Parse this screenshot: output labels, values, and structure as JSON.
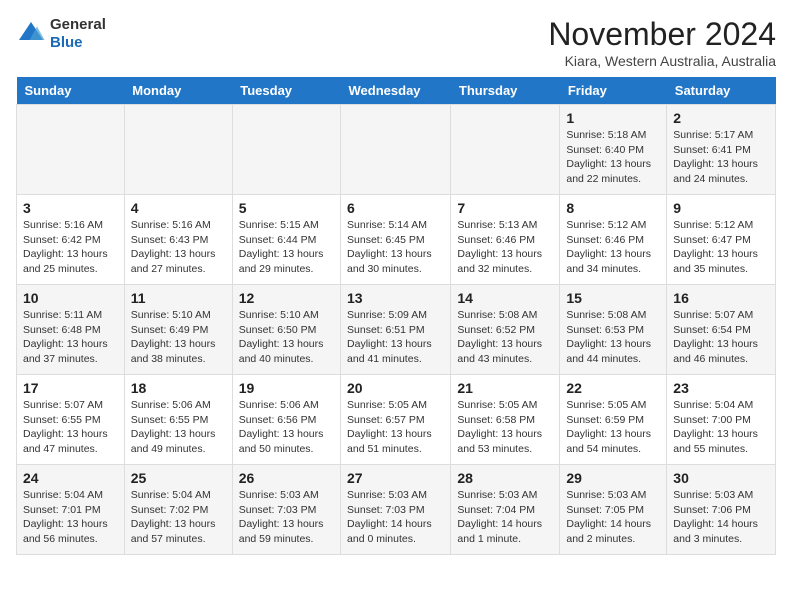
{
  "logo": {
    "general": "General",
    "blue": "Blue"
  },
  "header": {
    "month": "November 2024",
    "location": "Kiara, Western Australia, Australia"
  },
  "days_of_week": [
    "Sunday",
    "Monday",
    "Tuesday",
    "Wednesday",
    "Thursday",
    "Friday",
    "Saturday"
  ],
  "weeks": [
    [
      {
        "day": "",
        "info": ""
      },
      {
        "day": "",
        "info": ""
      },
      {
        "day": "",
        "info": ""
      },
      {
        "day": "",
        "info": ""
      },
      {
        "day": "",
        "info": ""
      },
      {
        "day": "1",
        "info": "Sunrise: 5:18 AM\nSunset: 6:40 PM\nDaylight: 13 hours and 22 minutes."
      },
      {
        "day": "2",
        "info": "Sunrise: 5:17 AM\nSunset: 6:41 PM\nDaylight: 13 hours and 24 minutes."
      }
    ],
    [
      {
        "day": "3",
        "info": "Sunrise: 5:16 AM\nSunset: 6:42 PM\nDaylight: 13 hours and 25 minutes."
      },
      {
        "day": "4",
        "info": "Sunrise: 5:16 AM\nSunset: 6:43 PM\nDaylight: 13 hours and 27 minutes."
      },
      {
        "day": "5",
        "info": "Sunrise: 5:15 AM\nSunset: 6:44 PM\nDaylight: 13 hours and 29 minutes."
      },
      {
        "day": "6",
        "info": "Sunrise: 5:14 AM\nSunset: 6:45 PM\nDaylight: 13 hours and 30 minutes."
      },
      {
        "day": "7",
        "info": "Sunrise: 5:13 AM\nSunset: 6:46 PM\nDaylight: 13 hours and 32 minutes."
      },
      {
        "day": "8",
        "info": "Sunrise: 5:12 AM\nSunset: 6:46 PM\nDaylight: 13 hours and 34 minutes."
      },
      {
        "day": "9",
        "info": "Sunrise: 5:12 AM\nSunset: 6:47 PM\nDaylight: 13 hours and 35 minutes."
      }
    ],
    [
      {
        "day": "10",
        "info": "Sunrise: 5:11 AM\nSunset: 6:48 PM\nDaylight: 13 hours and 37 minutes."
      },
      {
        "day": "11",
        "info": "Sunrise: 5:10 AM\nSunset: 6:49 PM\nDaylight: 13 hours and 38 minutes."
      },
      {
        "day": "12",
        "info": "Sunrise: 5:10 AM\nSunset: 6:50 PM\nDaylight: 13 hours and 40 minutes."
      },
      {
        "day": "13",
        "info": "Sunrise: 5:09 AM\nSunset: 6:51 PM\nDaylight: 13 hours and 41 minutes."
      },
      {
        "day": "14",
        "info": "Sunrise: 5:08 AM\nSunset: 6:52 PM\nDaylight: 13 hours and 43 minutes."
      },
      {
        "day": "15",
        "info": "Sunrise: 5:08 AM\nSunset: 6:53 PM\nDaylight: 13 hours and 44 minutes."
      },
      {
        "day": "16",
        "info": "Sunrise: 5:07 AM\nSunset: 6:54 PM\nDaylight: 13 hours and 46 minutes."
      }
    ],
    [
      {
        "day": "17",
        "info": "Sunrise: 5:07 AM\nSunset: 6:55 PM\nDaylight: 13 hours and 47 minutes."
      },
      {
        "day": "18",
        "info": "Sunrise: 5:06 AM\nSunset: 6:55 PM\nDaylight: 13 hours and 49 minutes."
      },
      {
        "day": "19",
        "info": "Sunrise: 5:06 AM\nSunset: 6:56 PM\nDaylight: 13 hours and 50 minutes."
      },
      {
        "day": "20",
        "info": "Sunrise: 5:05 AM\nSunset: 6:57 PM\nDaylight: 13 hours and 51 minutes."
      },
      {
        "day": "21",
        "info": "Sunrise: 5:05 AM\nSunset: 6:58 PM\nDaylight: 13 hours and 53 minutes."
      },
      {
        "day": "22",
        "info": "Sunrise: 5:05 AM\nSunset: 6:59 PM\nDaylight: 13 hours and 54 minutes."
      },
      {
        "day": "23",
        "info": "Sunrise: 5:04 AM\nSunset: 7:00 PM\nDaylight: 13 hours and 55 minutes."
      }
    ],
    [
      {
        "day": "24",
        "info": "Sunrise: 5:04 AM\nSunset: 7:01 PM\nDaylight: 13 hours and 56 minutes."
      },
      {
        "day": "25",
        "info": "Sunrise: 5:04 AM\nSunset: 7:02 PM\nDaylight: 13 hours and 57 minutes."
      },
      {
        "day": "26",
        "info": "Sunrise: 5:03 AM\nSunset: 7:03 PM\nDaylight: 13 hours and 59 minutes."
      },
      {
        "day": "27",
        "info": "Sunrise: 5:03 AM\nSunset: 7:03 PM\nDaylight: 14 hours and 0 minutes."
      },
      {
        "day": "28",
        "info": "Sunrise: 5:03 AM\nSunset: 7:04 PM\nDaylight: 14 hours and 1 minute."
      },
      {
        "day": "29",
        "info": "Sunrise: 5:03 AM\nSunset: 7:05 PM\nDaylight: 14 hours and 2 minutes."
      },
      {
        "day": "30",
        "info": "Sunrise: 5:03 AM\nSunset: 7:06 PM\nDaylight: 14 hours and 3 minutes."
      }
    ]
  ]
}
